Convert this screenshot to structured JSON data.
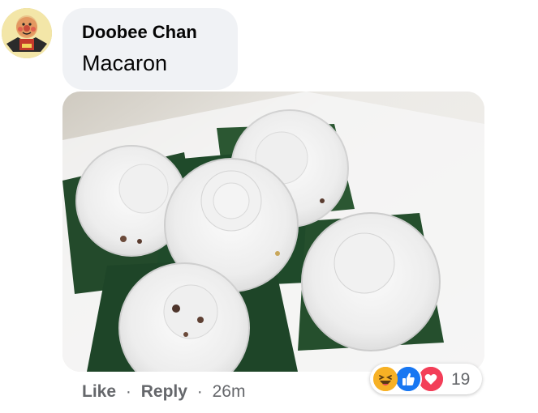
{
  "comment": {
    "author": "Doobee Chan",
    "text": "Macaron"
  },
  "actions": {
    "like": "Like",
    "dot": "·",
    "reply": "Reply",
    "time": "26m"
  },
  "reactions": {
    "icons": [
      "haha-icon",
      "like-icon",
      "love-icon"
    ],
    "count": "19",
    "colors": {
      "haha": "#f7b125",
      "like": "#1877f2",
      "love": "#f33e58"
    }
  }
}
